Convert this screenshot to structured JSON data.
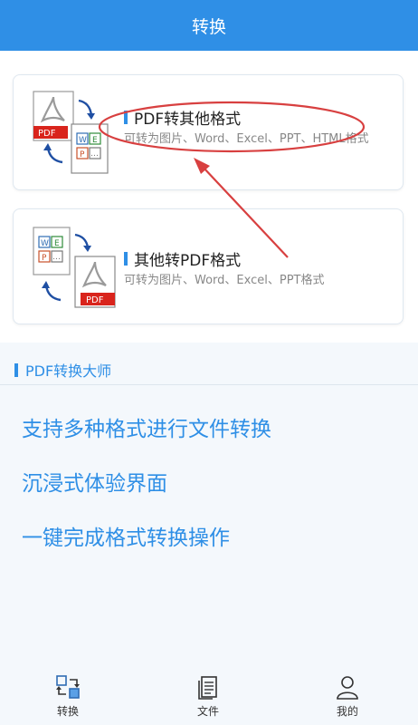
{
  "header": {
    "title": "转换"
  },
  "cards": [
    {
      "title": "PDF转其他格式",
      "desc": "可转为图片、Word、Excel、PPT、HTML格式",
      "icon_top_label": "PDF"
    },
    {
      "title": "其他转PDF格式",
      "desc": "可转为图片、Word、Excel、PPT格式",
      "icon_bottom_label": "PDF"
    }
  ],
  "doc_icon_letters": [
    "W",
    "E",
    "P",
    "…"
  ],
  "section": {
    "title": "PDF转换大师"
  },
  "features": [
    "支持多种格式进行文件转换",
    "沉浸式体验界面",
    "一键完成格式转换操作"
  ],
  "tabs": [
    {
      "label": "转换",
      "icon": "convert-icon"
    },
    {
      "label": "文件",
      "icon": "file-icon"
    },
    {
      "label": "我的",
      "icon": "user-icon"
    }
  ],
  "colors": {
    "accent": "#2f8fe6",
    "pdf_red": "#d9241c",
    "annotation_red": "#d84040"
  }
}
